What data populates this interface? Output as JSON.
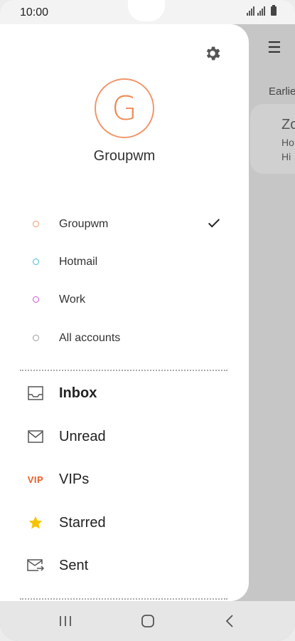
{
  "status_bar": {
    "time": "10:00"
  },
  "background_app": {
    "menu_glyph": "☰",
    "section_label": "Earlier",
    "card": {
      "line1": "Zo",
      "line2": "Ho",
      "line3": "Hi"
    }
  },
  "drawer": {
    "profile": {
      "initial": "G",
      "name": "Groupwm",
      "avatar_color": "#f0986a"
    },
    "accounts": [
      {
        "label": "Groupwm",
        "dot_color": "#f0986a",
        "selected": true
      },
      {
        "label": "Hotmail",
        "dot_color": "#4ab8d8",
        "selected": false
      },
      {
        "label": "Work",
        "dot_color": "#d24fd6",
        "selected": false
      },
      {
        "label": "All accounts",
        "dot_color": "#9a9a9a",
        "selected": false
      }
    ],
    "folders": [
      {
        "label": "Inbox",
        "icon": "inbox-icon",
        "bold": true
      },
      {
        "label": "Unread",
        "icon": "envelope-icon",
        "bold": false
      },
      {
        "label": "VIPs",
        "icon": "vip-icon",
        "icon_text": "VIP",
        "bold": false
      },
      {
        "label": "Starred",
        "icon": "star-icon",
        "icon_color": "#f5c400",
        "bold": false
      },
      {
        "label": "Sent",
        "icon": "sent-icon",
        "bold": false
      }
    ]
  },
  "nav_bar": {
    "buttons": [
      "recents-icon",
      "home-icon",
      "back-icon"
    ]
  }
}
